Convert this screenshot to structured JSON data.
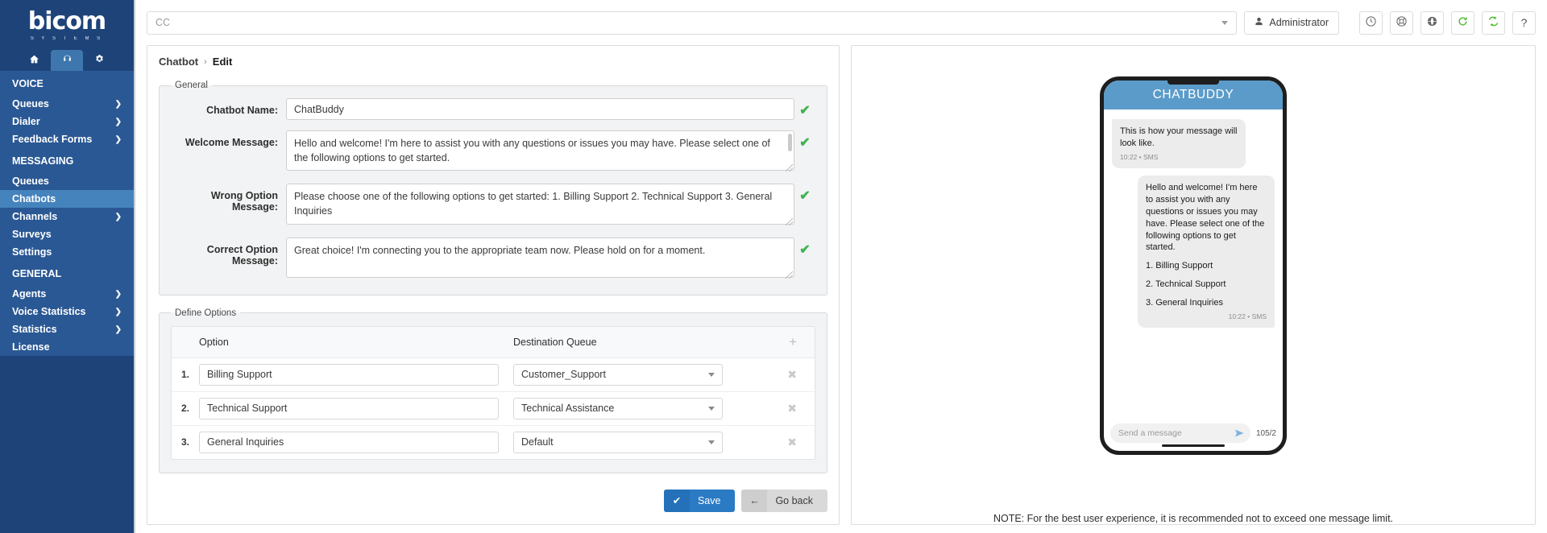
{
  "brand": {
    "name": "bicom",
    "tagline": "S Y S T E M S",
    "sidebar_bg": "#2a5894",
    "accent": "#2a7ac4"
  },
  "sidebar": {
    "tabs": [
      {
        "name": "home-tab",
        "icon": "home-icon",
        "active": false
      },
      {
        "name": "contact-center-tab",
        "icon": "headset-icon",
        "active": true
      },
      {
        "name": "settings-tab",
        "icon": "gears-icon",
        "active": false
      }
    ],
    "groups": [
      {
        "title": "VOICE",
        "items": [
          {
            "label": "Queues",
            "chevron": true,
            "selected": false
          },
          {
            "label": "Dialer",
            "chevron": true,
            "selected": false
          },
          {
            "label": "Feedback Forms",
            "chevron": true,
            "selected": false
          }
        ]
      },
      {
        "title": "MESSAGING",
        "items": [
          {
            "label": "Queues",
            "chevron": false,
            "selected": false
          },
          {
            "label": "Chatbots",
            "chevron": false,
            "selected": true
          },
          {
            "label": "Channels",
            "chevron": true,
            "selected": false
          },
          {
            "label": "Surveys",
            "chevron": false,
            "selected": false
          },
          {
            "label": "Settings",
            "chevron": false,
            "selected": false
          }
        ]
      },
      {
        "title": "GENERAL",
        "items": [
          {
            "label": "Agents",
            "chevron": true,
            "selected": false
          },
          {
            "label": "Voice Statistics",
            "chevron": true,
            "selected": false
          },
          {
            "label": "Statistics",
            "chevron": true,
            "selected": false
          },
          {
            "label": "License",
            "chevron": false,
            "selected": false
          }
        ]
      }
    ]
  },
  "topbar": {
    "search_value": "CC",
    "search_placeholder": "CC",
    "admin_label": "Administrator",
    "icons": [
      {
        "name": "clock-icon",
        "glyph": "clock"
      },
      {
        "name": "lifebuoy-icon",
        "glyph": "lifebuoy"
      },
      {
        "name": "globe-icon",
        "glyph": "globe"
      },
      {
        "name": "refresh-icon",
        "glyph": "refresh",
        "color": "#4eb82c"
      },
      {
        "name": "sync-icon",
        "glyph": "sync",
        "color": "#4eb82c"
      },
      {
        "name": "help-icon",
        "glyph": "?"
      }
    ]
  },
  "breadcrumb": {
    "root": "Chatbot",
    "separator": "›",
    "leaf": "Edit"
  },
  "general": {
    "legend": "General",
    "fields": [
      {
        "label": "Chatbot Name:",
        "value": "ChatBuddy",
        "type": "input",
        "valid": true,
        "check": "✔"
      },
      {
        "label": "Welcome Message:",
        "value": "Hello and welcome! I'm here to assist you with any questions or issues you may have. Please select one of the following options to get started.",
        "type": "textarea",
        "valid": true,
        "check": "✔"
      },
      {
        "label": "Wrong Option Message:",
        "value": "Please choose one of the following options to get started: 1. Billing Support 2. Technical Support 3. General Inquiries",
        "type": "textarea",
        "valid": true,
        "check": "✔"
      },
      {
        "label": "Correct Option Message:",
        "value": "Great choice! I'm connecting you to the appropriate team now. Please hold on for a moment.",
        "type": "textarea",
        "valid": true,
        "check": "✔"
      }
    ]
  },
  "define_options": {
    "legend": "Define Options",
    "headers": {
      "option": "Option",
      "queue": "Destination Queue",
      "add": "+"
    },
    "rows": [
      {
        "num": "1.",
        "option": "Billing Support",
        "queue": "Customer_Support",
        "delete": "✖"
      },
      {
        "num": "2.",
        "option": "Technical Support",
        "queue": "Technical Assistance",
        "delete": "✖"
      },
      {
        "num": "3.",
        "option": "General Inquiries",
        "queue": "Default",
        "delete": "✖"
      }
    ]
  },
  "actions": {
    "save_label": "Save",
    "save_icon": "✔",
    "back_label": "Go back",
    "back_icon": "←"
  },
  "preview": {
    "phone_title": "CHATBUDDY",
    "messages": [
      {
        "side": "left",
        "lines": [
          "This is how your message will look like."
        ],
        "options": [],
        "meta": "10:22 • SMS"
      },
      {
        "side": "right",
        "lines": [
          "Hello and welcome! I'm here to assist you with any questions or issues you may have. Please select one of the following options to get started."
        ],
        "options": [
          "1. Billing Support",
          "2. Technical Support",
          "3. General Inquiries"
        ],
        "meta": "10:22 • SMS"
      }
    ],
    "input_placeholder": "Send a message",
    "counter": "105/2",
    "note": "NOTE: For the best user experience, it is recommended not to exceed one message limit."
  }
}
